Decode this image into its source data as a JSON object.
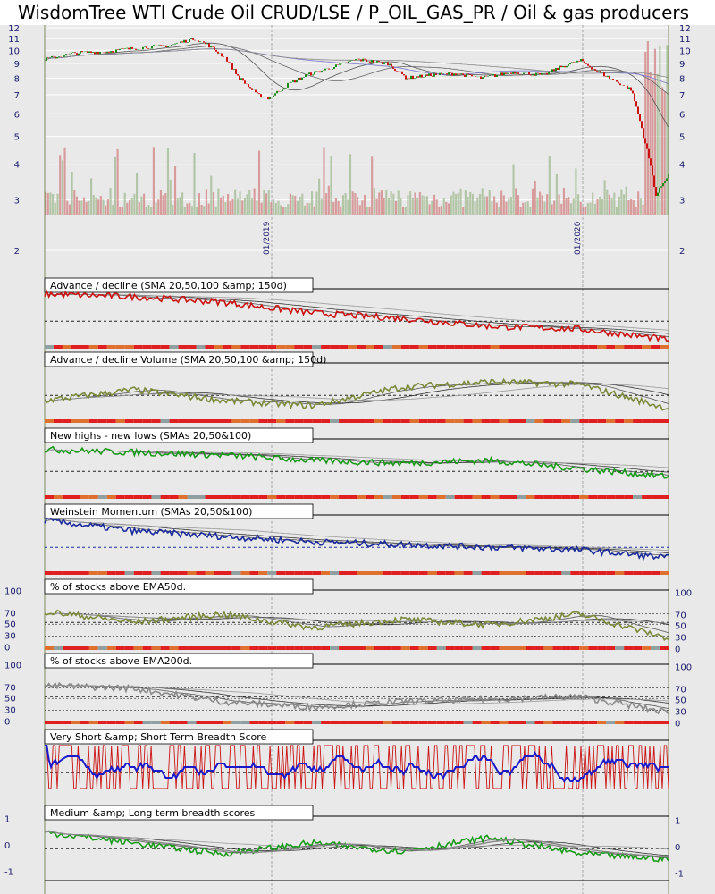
{
  "title": "WisdomTree WTI Crude Oil CRUD/LSE / P_OIL_GAS_PR / Oil & gas producers",
  "chart_data": {
    "type": "line",
    "x_dates": [
      "01/2019",
      "01/2020"
    ],
    "price_axis_ticks": [
      2,
      3,
      4,
      5,
      6,
      7,
      8,
      9,
      10,
      11,
      12
    ],
    "price_axis_scale": "log",
    "price_series": [
      {
        "t": 0,
        "v": 9.3
      },
      {
        "t": 0.05,
        "v": 9.8
      },
      {
        "t": 0.1,
        "v": 9.9
      },
      {
        "t": 0.15,
        "v": 10.2
      },
      {
        "t": 0.2,
        "v": 10.4
      },
      {
        "t": 0.24,
        "v": 11.0
      },
      {
        "t": 0.26,
        "v": 10.5
      },
      {
        "t": 0.29,
        "v": 9.4
      },
      {
        "t": 0.31,
        "v": 8.1
      },
      {
        "t": 0.34,
        "v": 7.0
      },
      {
        "t": 0.36,
        "v": 6.8
      },
      {
        "t": 0.39,
        "v": 7.6
      },
      {
        "t": 0.42,
        "v": 8.2
      },
      {
        "t": 0.46,
        "v": 8.7
      },
      {
        "t": 0.5,
        "v": 9.3
      },
      {
        "t": 0.55,
        "v": 9.0
      },
      {
        "t": 0.58,
        "v": 8.0
      },
      {
        "t": 0.62,
        "v": 8.2
      },
      {
        "t": 0.66,
        "v": 8.3
      },
      {
        "t": 0.7,
        "v": 8.0
      },
      {
        "t": 0.75,
        "v": 8.4
      },
      {
        "t": 0.8,
        "v": 8.2
      },
      {
        "t": 0.83,
        "v": 8.8
      },
      {
        "t": 0.86,
        "v": 9.2
      },
      {
        "t": 0.88,
        "v": 8.6
      },
      {
        "t": 0.91,
        "v": 7.9
      },
      {
        "t": 0.94,
        "v": 7.3
      },
      {
        "t": 0.96,
        "v": 5.0
      },
      {
        "t": 0.98,
        "v": 3.1
      },
      {
        "t": 1.0,
        "v": 3.7
      }
    ],
    "panels": [
      {
        "title": "Advance / decline (SMA 20,50,100 &amp; 150d)",
        "color": "#cc1111"
      },
      {
        "title": "Advance / decline Volume (SMA 20,50,100 &amp; 150d)",
        "color": "#7a8a3a"
      },
      {
        "title": "New highs - new lows (SMAs 20,50&100)",
        "color": "#1a9a1a"
      },
      {
        "title": "Weinstein Momentum (SMAs 20,50&100)",
        "color": "#1a2a9a"
      },
      {
        "title": "% of stocks above EMA50d.",
        "color": "#7a8a3a",
        "ticks": [
          "100",
          "70",
          "50",
          "30",
          "0"
        ]
      },
      {
        "title": "% of stocks above EMA200d.",
        "color": "#8a8a8a",
        "ticks": [
          "100",
          "70",
          "50",
          "30",
          "0"
        ]
      },
      {
        "title": "Very Short &amp; Short Term Breadth Score",
        "color": "#cc1111"
      },
      {
        "title": "Medium &amp; Long term breadth scores",
        "color": "#1a9a1a",
        "ticks": [
          "1",
          "0",
          "-1"
        ]
      }
    ],
    "colors": {
      "up": "#1a8a1a",
      "down": "#cc1111",
      "volume": "#d08080",
      "background": "#e9e9e9"
    }
  }
}
